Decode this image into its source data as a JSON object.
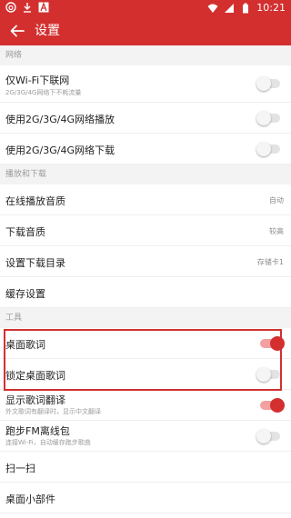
{
  "status_bar": {
    "icons_left": [
      "netease-cloud-music-icon",
      "download-icon",
      "a-icon"
    ],
    "time": "10:21",
    "icons_right": [
      "wifi-icon",
      "signal-icon",
      "battery-icon"
    ]
  },
  "app_bar": {
    "title": "设置",
    "back_icon": "arrow-left-icon"
  },
  "sections": {
    "network": {
      "header": "网络"
    },
    "playback": {
      "header": "播放和下载"
    },
    "tools": {
      "header": "工具"
    }
  },
  "items": {
    "wifi_only_download": {
      "label": "仅Wi-Fi下联网",
      "sub": "2G/3G/4G网络下不耗流量",
      "toggle": false
    },
    "mobile_play": {
      "label": "使用2G/3G/4G网络播放",
      "toggle": false
    },
    "mobile_download": {
      "label": "使用2G/3G/4G网络下载",
      "toggle": false
    },
    "online_quality": {
      "label": "在线播放音质",
      "value": "自动"
    },
    "download_quality": {
      "label": "下载音质",
      "value": "较高"
    },
    "download_dir": {
      "label": "设置下载目录",
      "value": "存储卡1"
    },
    "cache": {
      "label": "缓存设置"
    },
    "desktop_lyrics": {
      "label": "桌面歌词",
      "toggle": true
    },
    "lock_desktop_lyrics": {
      "label": "锁定桌面歌词",
      "toggle": false
    },
    "lyric_translation": {
      "label": "显示歌词翻译",
      "sub": "外文歌词有翻译时，显示中文翻译",
      "toggle": true
    },
    "fm_offline": {
      "label": "跑步FM离线包",
      "sub": "连接Wi-Fi，自动缓存跑步歌曲",
      "toggle": false
    },
    "scan": {
      "label": "扫一扫"
    },
    "widget": {
      "label": "桌面小部件"
    }
  },
  "colors": {
    "accent": "#d32f2f",
    "divider": "#eeeeee",
    "section_bg": "#f3f3f3"
  }
}
